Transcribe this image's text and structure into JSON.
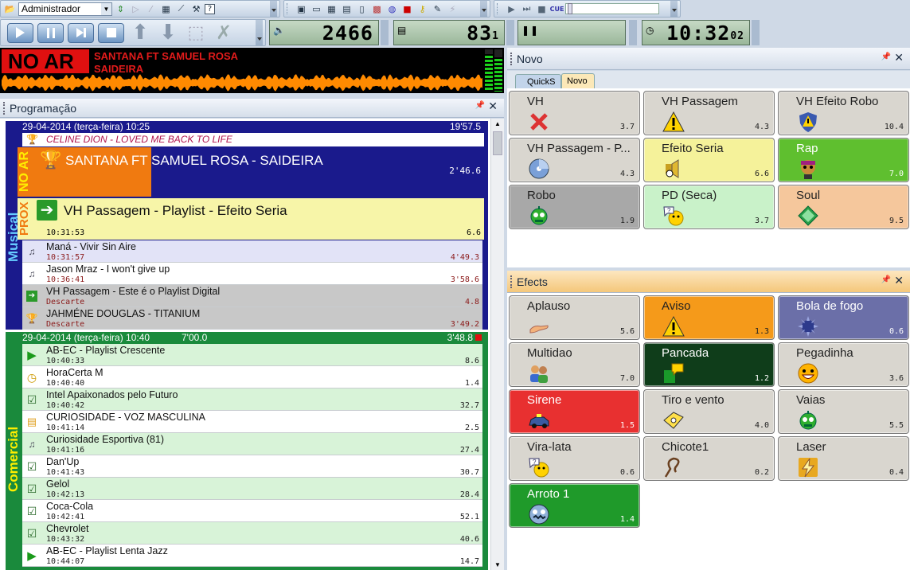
{
  "toolbar": {
    "user_select": "Administrador",
    "counter_volume": "2466",
    "counter_volume_small": "",
    "counter_playlist": "83",
    "counter_playlist_small": "1",
    "counter_clock": "10:32",
    "counter_clock_small": "02"
  },
  "onair": {
    "label": "NO AR",
    "artist": "SANTANA FT SAMUEL ROSA",
    "title": "SAIDEIRA"
  },
  "programacao": {
    "title": "Programação",
    "musical": {
      "vertical_label": "Musical",
      "header_date": "29-04-2014 (terça-feira) 10:25",
      "header_total": "19'57.5",
      "prev_item": "CELINE DION  - LOVED ME BACK TO LIFE",
      "noar_tag": "NO AR",
      "noar_title": "SANTANA FT SAMUEL ROSA - SAIDEIRA",
      "noar_duration": "2'46.6",
      "prox_tag": "PROX",
      "prox_title": "VH Passagem - Playlist - Efeito Seria",
      "prox_time": "10:31:53",
      "prox_duration": "6.6",
      "items": [
        {
          "title": "Maná - Vivir Sin Aire",
          "time": "10:31:57",
          "duration": "4'49.3",
          "icon": "music-note-icon",
          "bg": "#e2e3f7"
        },
        {
          "title": "Jason Mraz - I won't give up",
          "time": "10:36:41",
          "duration": "3'58.6",
          "icon": "music-note-icon",
          "bg": "#ffffff"
        },
        {
          "title": "VH Passagem - Este é o Playlist Digital",
          "time": "Descarte",
          "duration": "4.8",
          "icon": "arrow-right-icon",
          "bg": "#c8c8c8"
        },
        {
          "title": "JAHMÉNE DOUGLAS - TITANIUM",
          "time": "Descarte",
          "duration": "3'49.2",
          "icon": "trophy-icon",
          "bg": "#c8c8c8"
        }
      ]
    },
    "comercial": {
      "vertical_label": "Comercial",
      "header_date": "29-04-2014 (terça-feira) 10:40",
      "header_mid": "7'00.0",
      "header_total": "3'48.8",
      "items": [
        {
          "title": "AB-EC - Playlist Crescente",
          "time": "10:40:33",
          "duration": "8.6",
          "icon": "play-circle-icon"
        },
        {
          "title": "HoraCerta M",
          "time": "10:40:40",
          "duration": "1.4",
          "icon": "clock-icon"
        },
        {
          "title": "Intel Apaixonados pelo Futuro",
          "time": "10:40:42",
          "duration": "32.7",
          "icon": "checkbox-icon"
        },
        {
          "title": "CURIOSIDADE - VOZ MASCULINA",
          "time": "10:41:14",
          "duration": "2.5",
          "icon": "folder-icon"
        },
        {
          "title": "Curiosidade Esportiva (81)",
          "time": "10:41:16",
          "duration": "27.4",
          "icon": "music-note-icon"
        },
        {
          "title": "Dan'Up",
          "time": "10:41:43",
          "duration": "30.7",
          "icon": "checkbox-icon"
        },
        {
          "title": "Gelol",
          "time": "10:42:13",
          "duration": "28.4",
          "icon": "checkbox-icon"
        },
        {
          "title": "Coca-Cola",
          "time": "10:42:41",
          "duration": "52.1",
          "icon": "checkbox-icon"
        },
        {
          "title": "Chevrolet",
          "time": "10:43:32",
          "duration": "40.6",
          "icon": "checkbox-icon"
        },
        {
          "title": "AB-EC - Playlist Lenta Jazz",
          "time": "10:44:07",
          "duration": "14.7",
          "icon": "play-circle-icon"
        }
      ]
    }
  },
  "novo": {
    "title": "Novo",
    "tabs": [
      {
        "label": "QuickS",
        "active": false
      },
      {
        "label": "Novo",
        "active": true
      }
    ],
    "tiles": [
      {
        "name": "VH",
        "duration": "3.7",
        "color": "#d9d6cf",
        "icon": "red-x-icon",
        "text": "#222"
      },
      {
        "name": "VH Passagem",
        "duration": "4.3",
        "color": "#d9d6cf",
        "icon": "warning-icon",
        "text": "#222"
      },
      {
        "name": "VH Efeito Robo",
        "duration": "10.4",
        "color": "#d9d6cf",
        "icon": "shield-warning-icon",
        "text": "#222"
      },
      {
        "name": "VH Passagem - P...",
        "duration": "4.3",
        "color": "#d9d6cf",
        "icon": "disc-icon",
        "text": "#222"
      },
      {
        "name": "Efeito Seria",
        "duration": "6.6",
        "color": "#f5f29a",
        "icon": "speaker-icon",
        "text": "#222"
      },
      {
        "name": "Rap",
        "duration": "7.0",
        "color": "#5fbf2f",
        "icon": "rapper-icon",
        "text": "#fff"
      },
      {
        "name": "Robo",
        "duration": "1.9",
        "color": "#a8a8a8",
        "icon": "robot-icon",
        "text": "#222"
      },
      {
        "name": "PD (Seca)",
        "duration": "3.7",
        "color": "#c9f2c9",
        "icon": "thinking-face-icon",
        "text": "#222"
      },
      {
        "name": "Soul",
        "duration": "9.5",
        "color": "#f5c79c",
        "icon": "diamond-icon",
        "text": "#222"
      }
    ]
  },
  "efects": {
    "title": "Efects",
    "tiles": [
      {
        "name": "Aplauso",
        "duration": "5.6",
        "color": "#d9d6cf",
        "icon": "hand-icon",
        "text": "#222"
      },
      {
        "name": "Aviso",
        "duration": "1.3",
        "color": "#f59a1a",
        "icon": "warning-icon",
        "text": "#222"
      },
      {
        "name": "Bola de fogo",
        "duration": "0.6",
        "color": "#6b6fa8",
        "icon": "spiked-ball-icon",
        "text": "#fff"
      },
      {
        "name": "Multidao",
        "duration": "7.0",
        "color": "#d9d6cf",
        "icon": "people-icon",
        "text": "#222"
      },
      {
        "name": "Pancada",
        "duration": "1.2",
        "color": "#0f3d1a",
        "icon": "chat-icon",
        "text": "#fff"
      },
      {
        "name": "Pegadinha",
        "duration": "3.6",
        "color": "#d9d6cf",
        "icon": "grin-face-icon",
        "text": "#222"
      },
      {
        "name": "Sirene",
        "duration": "1.5",
        "color": "#e83030",
        "icon": "car-icon",
        "text": "#fff"
      },
      {
        "name": "Tiro e vento",
        "duration": "4.0",
        "color": "#d9d6cf",
        "icon": "ticket-icon",
        "text": "#222"
      },
      {
        "name": "Vaias",
        "duration": "5.5",
        "color": "#d9d6cf",
        "icon": "robot-icon",
        "text": "#222"
      },
      {
        "name": "Vira-lata",
        "duration": "0.6",
        "color": "#d9d6cf",
        "icon": "thinking-face-icon",
        "text": "#222"
      },
      {
        "name": "Chicote1",
        "duration": "0.2",
        "color": "#d9d6cf",
        "icon": "whip-icon",
        "text": "#222"
      },
      {
        "name": "Laser",
        "duration": "0.4",
        "color": "#d9d6cf",
        "icon": "lightning-icon",
        "text": "#222"
      },
      {
        "name": "Arroto 1",
        "duration": "1.4",
        "color": "#1f9a2a",
        "icon": "monster-face-icon",
        "text": "#fff"
      }
    ]
  }
}
